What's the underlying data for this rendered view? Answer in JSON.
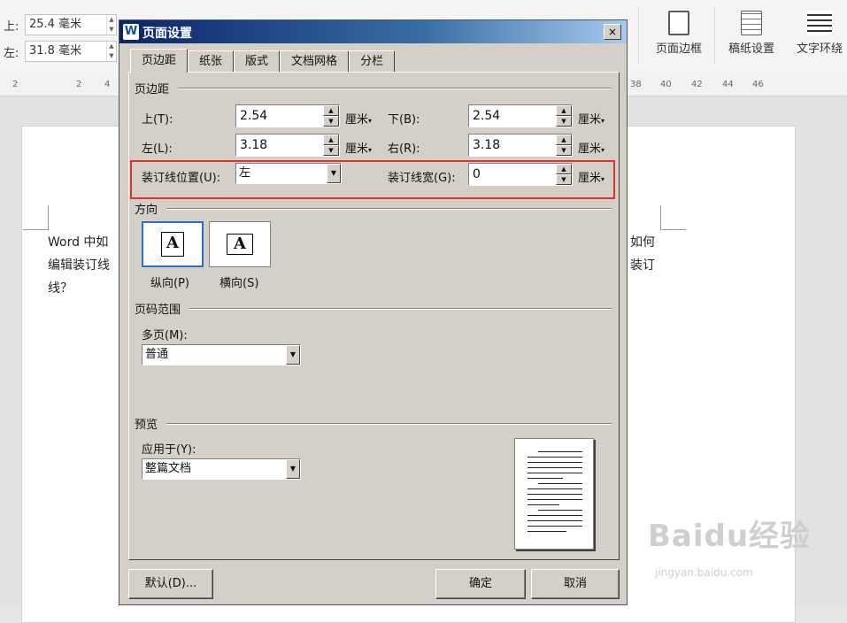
{
  "background": {
    "toolbar": {
      "top_label": "上:",
      "top_value": "25.4 毫米",
      "left_label": "左:",
      "left_value": "31.8 毫米",
      "buttons": [
        {
          "label": "页面边框",
          "icon": "page-border-icon"
        },
        {
          "label": "稿纸设置",
          "icon": "grid-paper-icon"
        },
        {
          "label": "文字环绕",
          "icon": "text-wrap-icon"
        }
      ]
    },
    "ruler": {
      "left_ticks": [
        "2",
        "2",
        "4"
      ],
      "right_ticks": [
        "38",
        "40",
        "42",
        "44",
        "46"
      ]
    },
    "document": {
      "line1_left": "Word 中如",
      "line1_right": "如何",
      "line2_left": "编辑装订线",
      "line2_right": "装订",
      "line3": "线？"
    },
    "watermark": {
      "logo": "Baidu经验",
      "url": "jingyan.baidu.com"
    }
  },
  "dialog": {
    "title": "页面设置",
    "app_icon": "W",
    "close_label": "×",
    "tabs": [
      {
        "label": "页边距",
        "active": true
      },
      {
        "label": "纸张",
        "active": false
      },
      {
        "label": "版式",
        "active": false
      },
      {
        "label": "文档网格",
        "active": false
      },
      {
        "label": "分栏",
        "active": false
      }
    ],
    "margins": {
      "group_label": "页边距",
      "top_label": "上(T):",
      "top_value": "2.54",
      "bottom_label": "下(B):",
      "bottom_value": "2.54",
      "left_label": "左(L):",
      "left_value": "3.18",
      "right_label": "右(R):",
      "right_value": "3.18",
      "unit": "厘米",
      "gutter_pos_label": "装订线位置(U):",
      "gutter_pos_value": "左",
      "gutter_width_label": "装订线宽(G):",
      "gutter_width_value": "0"
    },
    "orientation": {
      "group_label": "方向",
      "portrait_label": "纵向(P)",
      "landscape_label": "横向(S)",
      "glyph": "A"
    },
    "page_range": {
      "group_label": "页码范围",
      "multi_label": "多页(M):",
      "multi_value": "普通"
    },
    "preview": {
      "group_label": "预览",
      "apply_label": "应用于(Y):",
      "apply_value": "整篇文档"
    },
    "buttons": {
      "default": "默认(D)...",
      "ok": "确定",
      "cancel": "取消"
    }
  }
}
